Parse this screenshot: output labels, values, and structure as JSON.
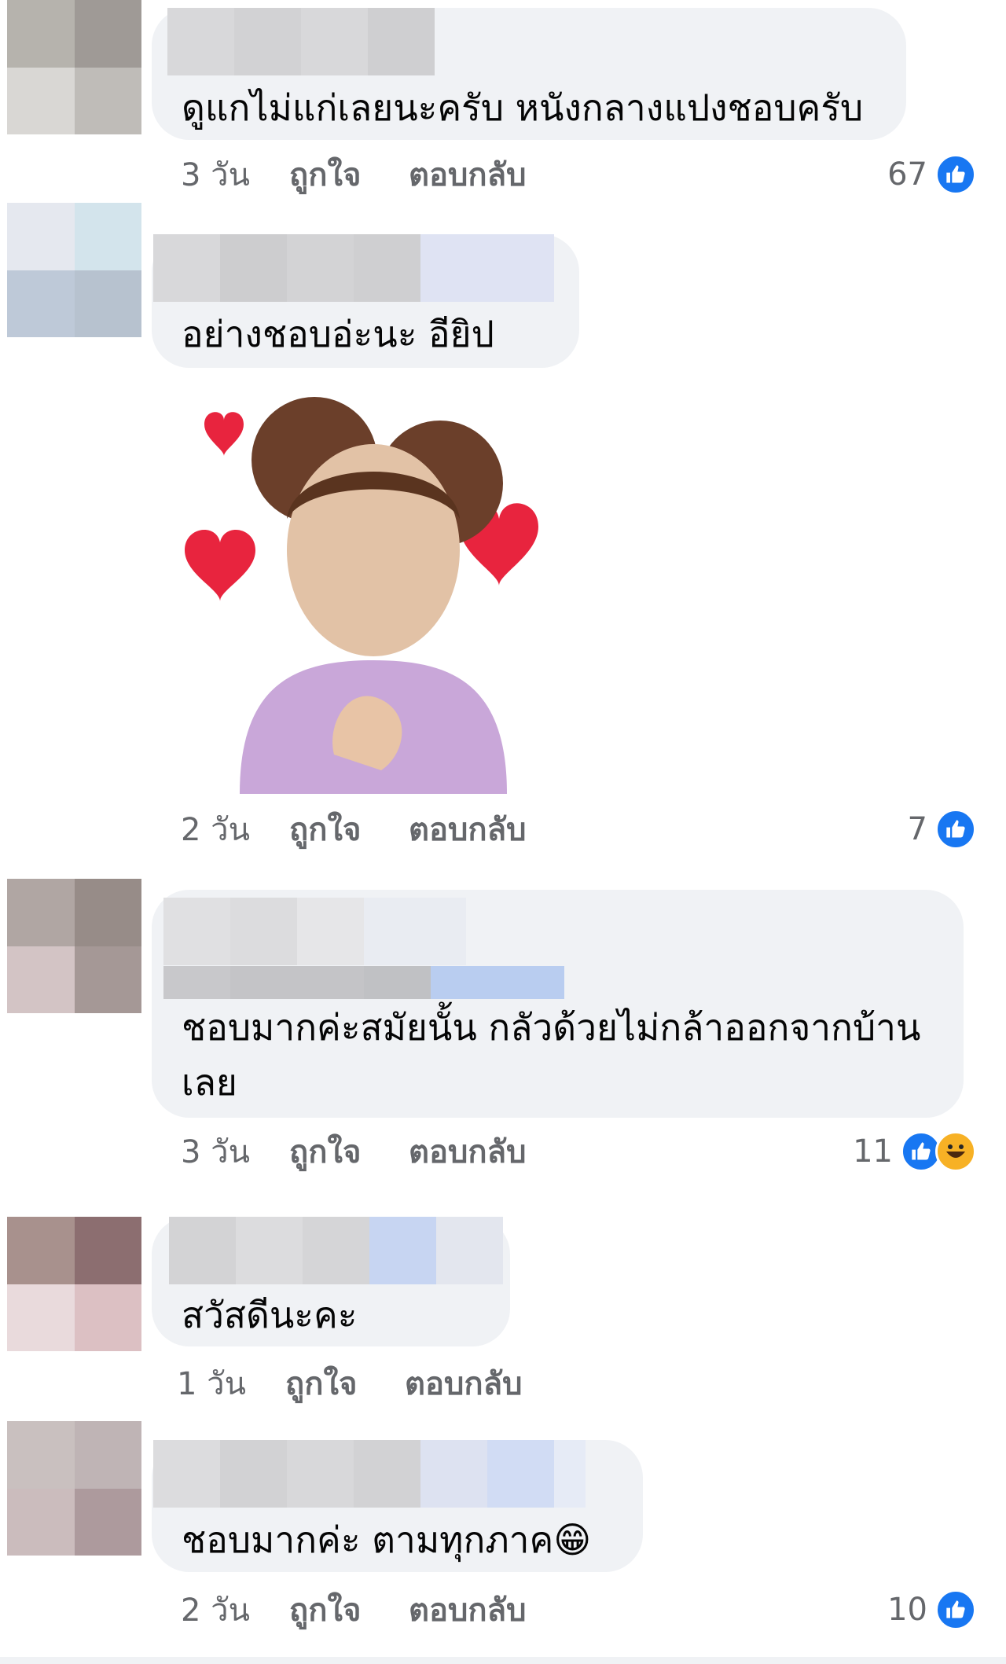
{
  "comments": [
    {
      "text": "ดูแกไม่แก่เลยนะครับ หนังกลางแปงชอบครับ",
      "time": "3 วัน",
      "like": "ถูกใจ",
      "reply": "ตอบกลับ",
      "reaction_count": "67",
      "reactions": [
        "like-icon"
      ]
    },
    {
      "text": "อย่างชอบอ่ะนะ อียิป",
      "time": "2 วัน",
      "like": "ถูกใจ",
      "reply": "ตอบกลับ",
      "reaction_count": "7",
      "reactions": [
        "like-icon"
      ],
      "attachment": "heart-sticker"
    },
    {
      "text": "ชอบมากค่ะสมัยนั้น กลัวด้วยไม่กล้าออกจากบ้านเลย",
      "time": "3 วัน",
      "like": "ถูกใจ",
      "reply": "ตอบกลับ",
      "reaction_count": "11",
      "reactions": [
        "like-icon",
        "haha-icon"
      ]
    },
    {
      "text": "สวัสดีนะคะ",
      "time": "1 วัน",
      "like": "ถูกใจ",
      "reply": "ตอบกลับ"
    },
    {
      "text": "ชอบมากค่ะ ตามทุกภาค",
      "emoji": "😁",
      "time": "2 วัน",
      "like": "ถูกใจ",
      "reply": "ตอบกลับ",
      "reaction_count": "10",
      "reactions": [
        "like-icon"
      ]
    }
  ],
  "colors": {
    "bubble": "#f0f2f5",
    "meta_text": "#65676b",
    "like_blue": "#1877f2",
    "haha_yellow": "#f7b125"
  }
}
